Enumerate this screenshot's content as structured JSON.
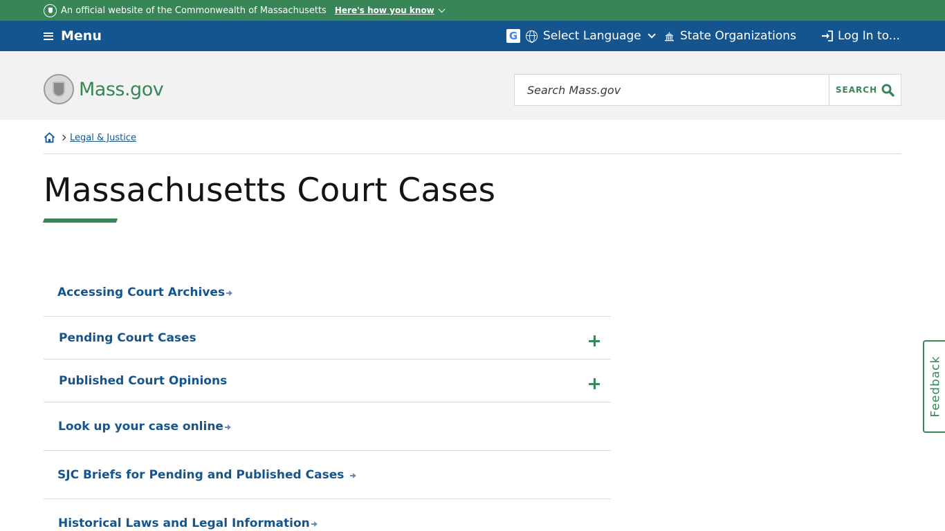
{
  "official_banner": {
    "text": "An official website of the Commonwealth of Massachusetts",
    "how_link": "Here's how you know"
  },
  "utility_nav": {
    "menu_label": "Menu",
    "language_label": "Select Language",
    "state_orgs_label": "State Organizations",
    "login_label": "Log In to..."
  },
  "header": {
    "logo_text": "Mass.gov",
    "search_placeholder": "Search Mass.gov",
    "search_button": "SEARCH"
  },
  "breadcrumb": {
    "items": [
      {
        "label": "Legal & Justice"
      }
    ]
  },
  "page": {
    "title": "Massachusetts Court Cases"
  },
  "links": [
    {
      "label": "Accessing Court Archives",
      "type": "link"
    },
    {
      "label": "Pending Court Cases",
      "type": "expandable"
    },
    {
      "label": "Published Court Opinions",
      "type": "expandable"
    },
    {
      "label": "Look up your case online",
      "type": "link"
    },
    {
      "label": "SJC Briefs for Pending and Published Cases",
      "type": "link"
    },
    {
      "label": "Historical Laws and Legal Information",
      "type": "link"
    }
  ],
  "feedback": {
    "label": "Feedback"
  },
  "colors": {
    "green": "#388557",
    "blue": "#14558f",
    "header_gray": "#f2f2f2"
  }
}
